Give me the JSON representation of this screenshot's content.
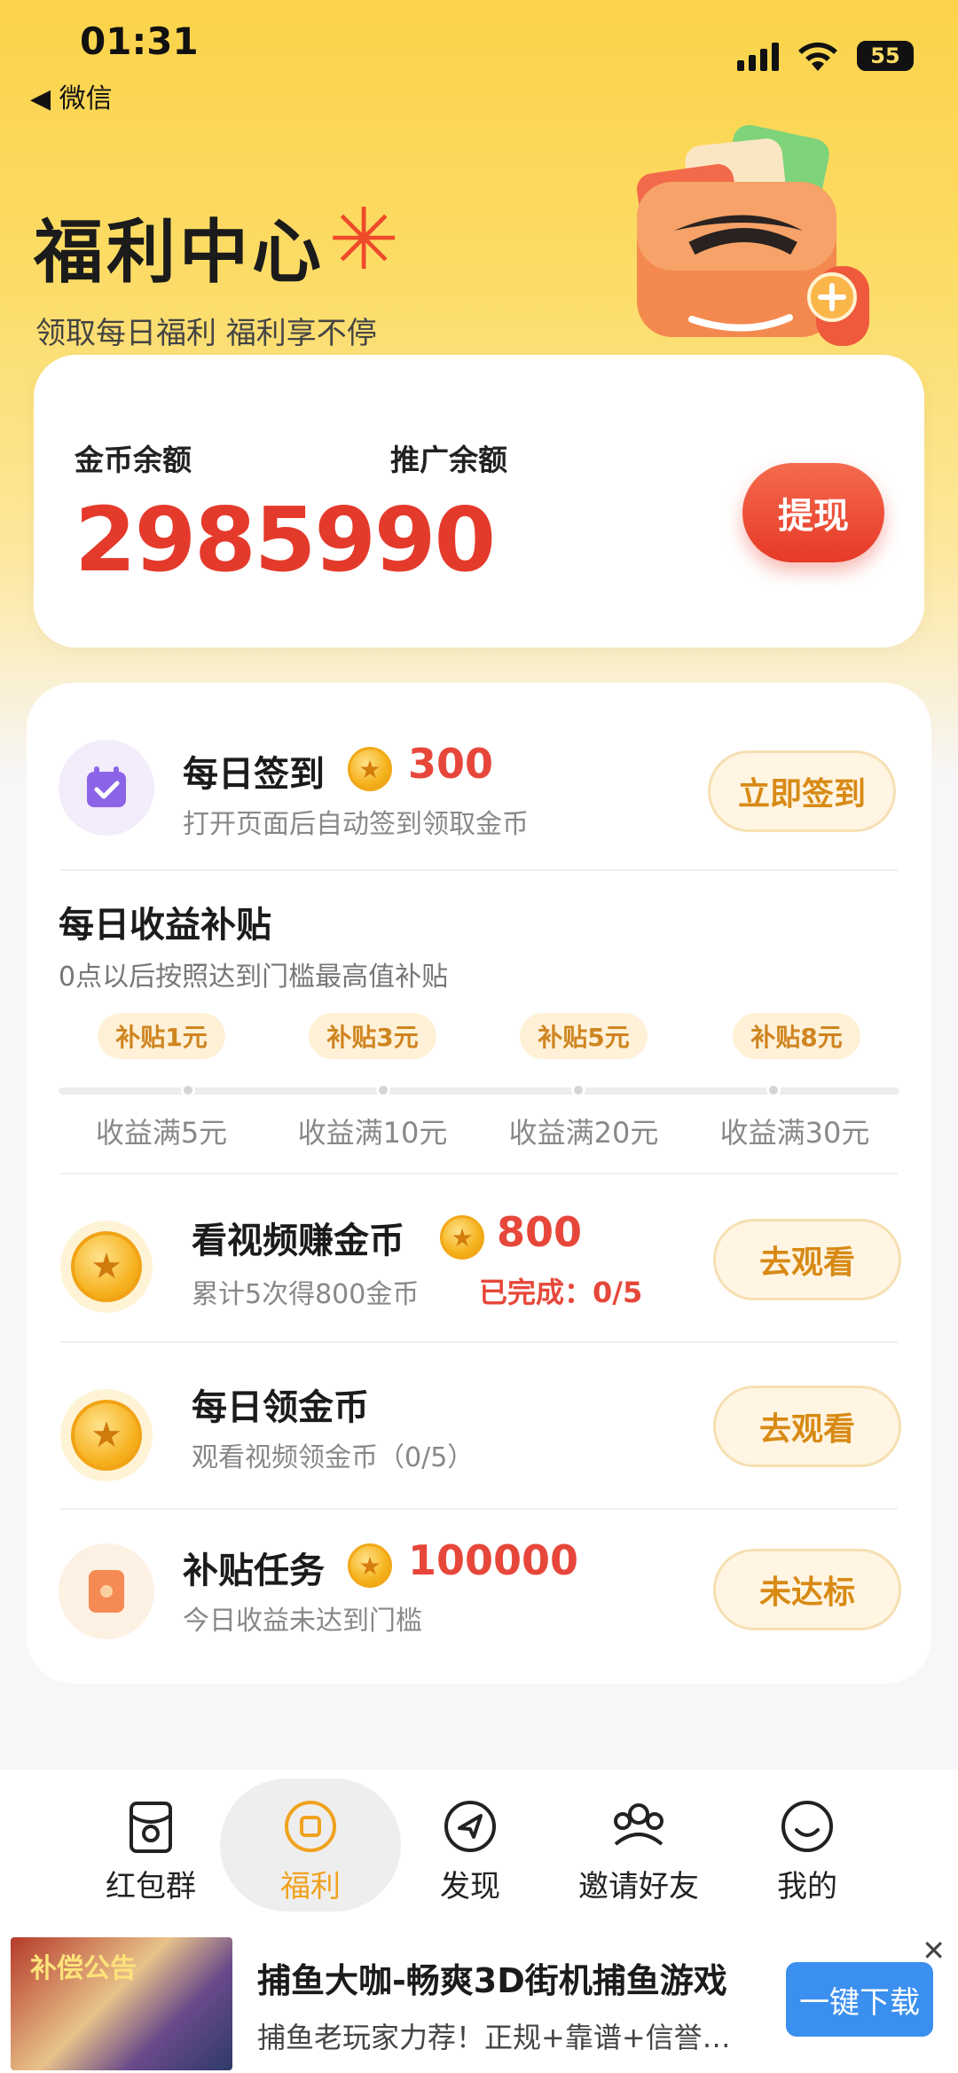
{
  "status_bar": {
    "time": "01:31",
    "back_label": "◀ 微信",
    "battery": "55"
  },
  "header": {
    "title": "福利中心",
    "subtitle": "领取每日福利 福利享不停"
  },
  "balance": {
    "coin_label": "金币余额",
    "promo_label": "推广余额",
    "value": "2985990",
    "withdraw_label": "提现"
  },
  "checkin": {
    "title": "每日签到",
    "reward": "300",
    "subtitle": "打开页面后自动签到领取金币",
    "button": "立即签到"
  },
  "subsidy": {
    "title": "每日收益补贴",
    "subtitle": "0点以后按照达到门槛最高值补贴",
    "tiers": [
      {
        "badge": "补贴1元",
        "label": "收益满5元"
      },
      {
        "badge": "补贴3元",
        "label": "收益满10元"
      },
      {
        "badge": "补贴5元",
        "label": "收益满20元"
      },
      {
        "badge": "补贴8元",
        "label": "收益满30元"
      }
    ]
  },
  "video_task": {
    "title": "看视频赚金币",
    "reward": "800",
    "subtitle": "累计5次得800金币",
    "progress": "已完成：0/5",
    "button": "去观看"
  },
  "daily_coin": {
    "title": "每日领金币",
    "subtitle": "观看视频领金币（0/5）",
    "button": "去观看"
  },
  "subsidy_task": {
    "title": "补贴任务",
    "reward": "100000",
    "subtitle": "今日收益未达到门槛",
    "button": "未达标"
  },
  "nav": {
    "items": [
      {
        "label": "红包群",
        "icon": "red-packet-icon"
      },
      {
        "label": "福利",
        "icon": "welfare-icon"
      },
      {
        "label": "发现",
        "icon": "discover-icon"
      },
      {
        "label": "邀请好友",
        "icon": "invite-icon"
      },
      {
        "label": "我的",
        "icon": "profile-icon"
      }
    ],
    "active_color": "#f0a21f"
  },
  "ad": {
    "image_text": "补偿公告",
    "title": "捕鱼大咖-畅爽3D街机捕鱼游戏",
    "subtitle": "捕鱼老玩家力荐！正规+靠谱+信誉…",
    "button": "一键下载",
    "close": "✕"
  },
  "colors": {
    "accent_red": "#e43a2c",
    "accent_gold": "#d88a15",
    "header_yellow": "#fbd34a",
    "ad_blue": "#3b8fef"
  }
}
